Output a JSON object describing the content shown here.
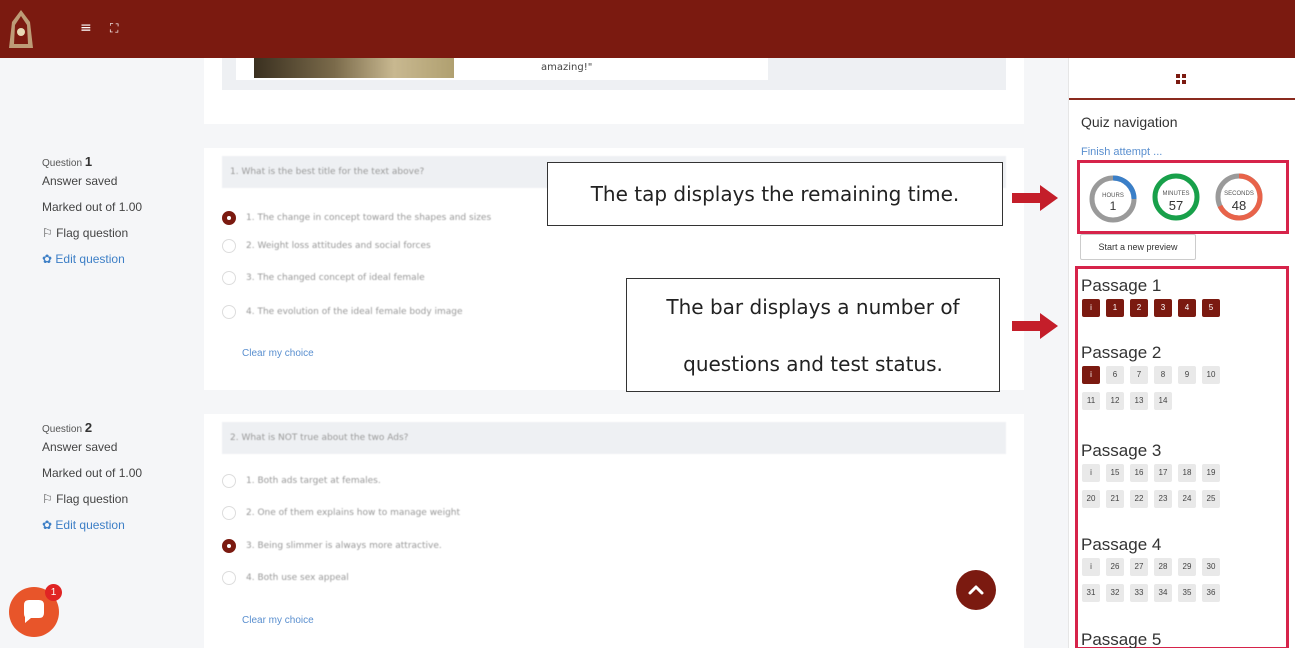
{
  "colors": {
    "brand": "#7b1a10",
    "highlight": "#d6234a",
    "link": "#5a8fcf"
  },
  "topbar": {
    "menu_icon": "≡",
    "fullscreen_icon": "⛶"
  },
  "banner": {
    "text": "amazing!\""
  },
  "questions": [
    {
      "label": "Question",
      "number": "1",
      "status": "Answer saved",
      "marks": "Marked out of 1.00",
      "flag": "Flag question",
      "edit": "Edit question",
      "text": "1. What is the best title for the text above?",
      "options": [
        "1. The change in concept toward the shapes and sizes",
        "2. Weight loss attitudes and social forces",
        "3. The changed concept of ideal female",
        "4. The evolution of the ideal female body image"
      ],
      "selected": 0,
      "clear": "Clear my choice"
    },
    {
      "label": "Question",
      "number": "2",
      "status": "Answer saved",
      "marks": "Marked out of 1.00",
      "flag": "Flag question",
      "edit": "Edit question",
      "text": "2. What is NOT true about the two Ads?",
      "options": [
        "1. Both ads target at females.",
        "2. One of them explains how to manage weight",
        "3. Being slimmer is always more attractive.",
        "4. Both use sex appeal"
      ],
      "selected": 2,
      "clear": "Clear my choice"
    }
  ],
  "callouts": {
    "timer": "The tap displays the remaining time.",
    "bar_line1": "The bar displays a number of",
    "bar_line2": "questions and test status."
  },
  "sidebar": {
    "title": "Quiz navigation",
    "finish": "Finish attempt ...",
    "timer": {
      "hours": {
        "label": "HOURS",
        "value": "1",
        "color": "#3a7fc8"
      },
      "minutes": {
        "label": "MINUTES",
        "value": "57",
        "color": "#18a04a"
      },
      "seconds": {
        "label": "SECONDS",
        "value": "48",
        "color": "#e8634a"
      }
    },
    "preview_button": "Start a new preview",
    "passages": [
      {
        "title": "Passage 1",
        "rows": [
          [
            {
              "t": "i",
              "d": true
            },
            {
              "t": "1",
              "d": true
            },
            {
              "t": "2",
              "d": true
            },
            {
              "t": "3",
              "d": true
            },
            {
              "t": "4",
              "d": true
            },
            {
              "t": "5",
              "d": true
            }
          ]
        ]
      },
      {
        "title": "Passage 2",
        "rows": [
          [
            {
              "t": "i",
              "d": true
            },
            {
              "t": "6"
            },
            {
              "t": "7"
            },
            {
              "t": "8"
            },
            {
              "t": "9"
            },
            {
              "t": "10"
            }
          ],
          [
            {
              "t": "11"
            },
            {
              "t": "12"
            },
            {
              "t": "13"
            },
            {
              "t": "14"
            }
          ]
        ]
      },
      {
        "title": "Passage 3",
        "rows": [
          [
            {
              "t": "i"
            },
            {
              "t": "15"
            },
            {
              "t": "16"
            },
            {
              "t": "17"
            },
            {
              "t": "18"
            },
            {
              "t": "19"
            }
          ],
          [
            {
              "t": "20"
            },
            {
              "t": "21"
            },
            {
              "t": "22"
            },
            {
              "t": "23"
            },
            {
              "t": "24"
            },
            {
              "t": "25"
            }
          ]
        ]
      },
      {
        "title": "Passage 4",
        "rows": [
          [
            {
              "t": "i"
            },
            {
              "t": "26"
            },
            {
              "t": "27"
            },
            {
              "t": "28"
            },
            {
              "t": "29"
            },
            {
              "t": "30"
            }
          ],
          [
            {
              "t": "31"
            },
            {
              "t": "32"
            },
            {
              "t": "33"
            },
            {
              "t": "34"
            },
            {
              "t": "35"
            },
            {
              "t": "36"
            }
          ]
        ]
      },
      {
        "title": "Passage 5",
        "rows": []
      }
    ]
  },
  "chat_badge": "1"
}
